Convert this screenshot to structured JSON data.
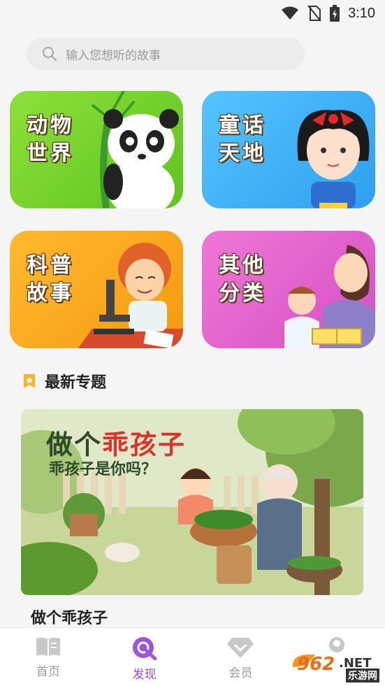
{
  "status_bar": {
    "time": "3:10",
    "icons": [
      "wifi-icon",
      "no-sim-icon",
      "battery-charging-icon"
    ]
  },
  "search": {
    "placeholder": "输入您想听的故事",
    "icon": "search-icon"
  },
  "categories": [
    {
      "title": "动物世界",
      "line1": "动物",
      "line2": "世界",
      "color": "#6ccc26"
    },
    {
      "title": "童话天地",
      "line1": "童话",
      "line2": "天地",
      "color": "#3db1f7"
    },
    {
      "title": "科普故事",
      "line1": "科普",
      "line2": "故事",
      "color": "#f7a81e"
    },
    {
      "title": "其他分类",
      "line1": "其他",
      "line2": "分类",
      "color": "#e262cd"
    }
  ],
  "section": {
    "title": "最新专题",
    "icon": "bookmark-star-icon",
    "accent": "#f4b528"
  },
  "featured_topic": {
    "banner_title_part1": "做个",
    "banner_title_part2": "乖孩子",
    "banner_subtitle": "乖孩子是你吗？",
    "title": "做个乖孩子"
  },
  "bottom_nav": {
    "items": [
      {
        "label": "首页",
        "icon": "book-icon",
        "active": false
      },
      {
        "label": "发现",
        "icon": "discover-search-icon",
        "active": true
      },
      {
        "label": "会员",
        "icon": "diamond-icon",
        "active": false
      },
      {
        "label": "",
        "icon": "profile-icon",
        "active": false
      }
    ],
    "active_color": "#9a4fd8"
  },
  "watermark": {
    "logo": "962.NET",
    "caption": "乐游网"
  }
}
